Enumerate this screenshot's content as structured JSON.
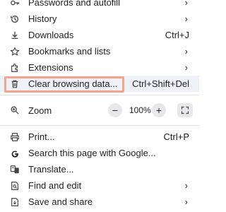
{
  "menu": {
    "items_top": [
      {
        "label": "Passwords and autofill",
        "icon": "key-icon",
        "chevron": true
      },
      {
        "label": "History",
        "icon": "history-icon",
        "chevron": true
      },
      {
        "label": "Downloads",
        "icon": "download-icon",
        "shortcut": "Ctrl+J"
      },
      {
        "label": "Bookmarks and lists",
        "icon": "star-icon",
        "chevron": true
      },
      {
        "label": "Extensions",
        "icon": "puzzle-icon",
        "chevron": true
      },
      {
        "label": "Clear browsing data...",
        "icon": "trash-icon",
        "shortcut": "Ctrl+Shift+Del"
      }
    ],
    "zoom": {
      "label": "Zoom",
      "value": "100%",
      "minus": "−",
      "plus": "+"
    },
    "items_bottom": [
      {
        "label": "Print...",
        "icon": "print-icon",
        "shortcut": "Ctrl+P"
      },
      {
        "label": "Search this page with Google...",
        "icon": "google-icon"
      },
      {
        "label": "Translate...",
        "icon": "translate-icon"
      },
      {
        "label": "Find and edit",
        "icon": "find-edit-icon",
        "chevron": true
      },
      {
        "label": "Save and share",
        "icon": "save-share-icon",
        "chevron": true
      }
    ],
    "highlight_color": "#f2a48c"
  }
}
